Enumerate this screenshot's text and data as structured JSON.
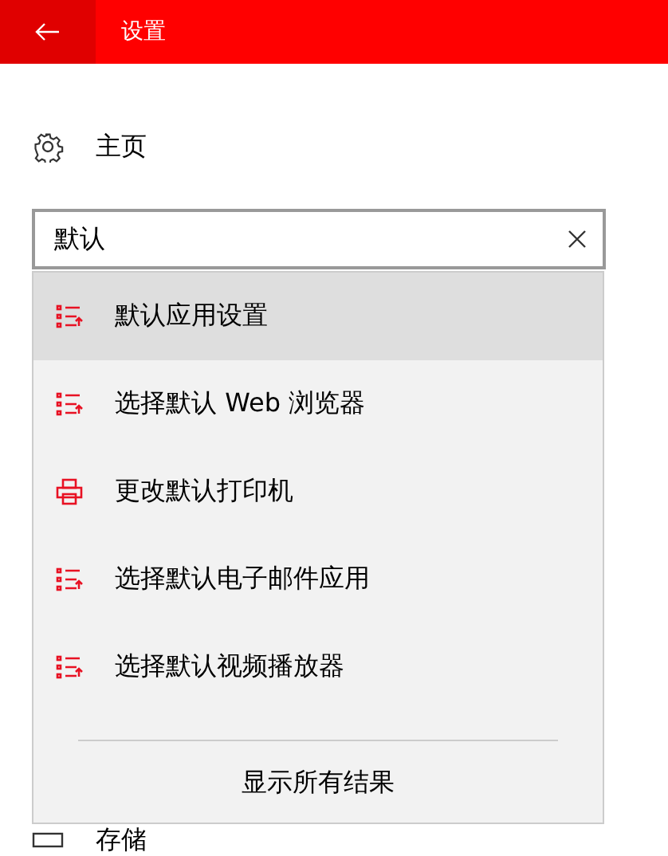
{
  "window": {
    "title": "设置"
  },
  "home": {
    "label": "主页"
  },
  "search": {
    "value": "默认"
  },
  "suggestions": [
    {
      "kind": "list",
      "label": "默认应用设置",
      "selected": true
    },
    {
      "kind": "list",
      "label": "选择默认 Web 浏览器",
      "selected": false
    },
    {
      "kind": "printer",
      "label": "更改默认打印机",
      "selected": false
    },
    {
      "kind": "list",
      "label": "选择默认电子邮件应用",
      "selected": false
    },
    {
      "kind": "list",
      "label": "选择默认视频播放器",
      "selected": false
    }
  ],
  "show_all": "显示所有结果",
  "nav_items": [
    {
      "kind": "storage",
      "label": "存储"
    }
  ]
}
